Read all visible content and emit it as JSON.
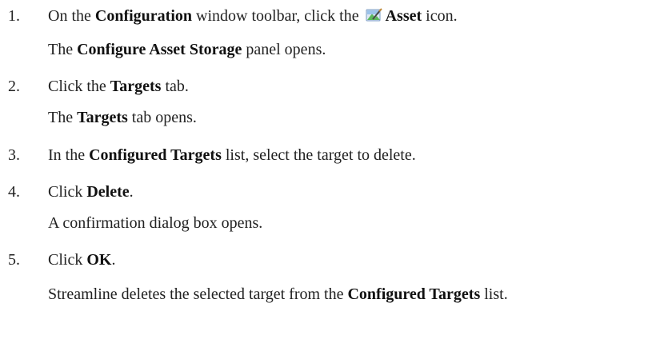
{
  "steps": [
    {
      "number": "1.",
      "parts": {
        "a": "On the ",
        "b": "Configuration",
        "c": " window toolbar, click the ",
        "d": "Asset",
        "e": " icon."
      },
      "result": {
        "a": "The ",
        "b": "Configure Asset Storage",
        "c": " panel opens."
      },
      "icon": "asset-icon"
    },
    {
      "number": "2.",
      "parts": {
        "a": "Click the ",
        "b": "Targets",
        "c": " tab."
      },
      "result": {
        "a": "The ",
        "b": "Targets",
        "c": " tab opens."
      }
    },
    {
      "number": "3.",
      "parts": {
        "a": "In the ",
        "b": "Configured Targets",
        "c": " list, select the target to delete."
      }
    },
    {
      "number": "4.",
      "parts": {
        "a": "Click ",
        "b": "Delete",
        "c": "."
      },
      "result": {
        "a": "A confirmation dialog box opens."
      }
    },
    {
      "number": "5.",
      "parts": {
        "a": "Click ",
        "b": "OK",
        "c": "."
      },
      "result": {
        "a": "Streamline deletes the selected target from the ",
        "b": "Configured Targets",
        "c": " list."
      }
    }
  ],
  "colors": {
    "text": "#222222",
    "icon_blue": "#4a90d9",
    "icon_green": "#5cb85c"
  }
}
